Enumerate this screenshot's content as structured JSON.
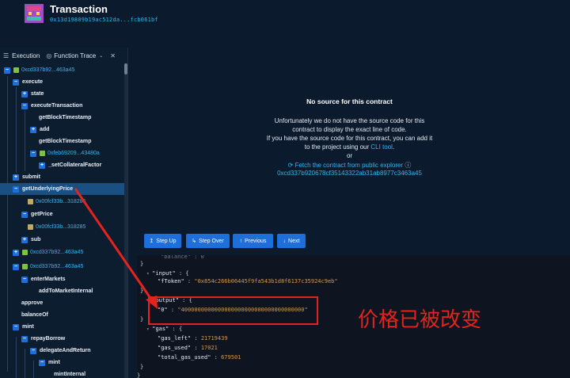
{
  "header": {
    "title": "Transaction",
    "hash": "0x13d19809b19ac512da...fcb061bf"
  },
  "sidebar": {
    "execution_label": "Execution",
    "function_trace_label": "Function Trace",
    "items": [
      {
        "label": "0xcd337b92...463a45",
        "contract": true
      },
      {
        "label": "execute"
      },
      {
        "label": "state"
      },
      {
        "label": "executeTransaction"
      },
      {
        "label": "getBlockTimestamp"
      },
      {
        "label": "add"
      },
      {
        "label": "getBlockTimestamp"
      },
      {
        "label": "0xfeb69209...43480a",
        "contract": true
      },
      {
        "label": "_setCollateralFactor"
      },
      {
        "label": "submit"
      },
      {
        "label": "getUnderlyingPrice"
      },
      {
        "label": "0x00fcf33b...318285",
        "contract": true
      },
      {
        "label": "getPrice"
      },
      {
        "label": "0x00fcf33b...318285",
        "contract": true
      },
      {
        "label": "sub"
      },
      {
        "label": "0xcd337b92...463a45",
        "contract": true
      },
      {
        "label": "0xcd337b92...463a45",
        "contract": true
      },
      {
        "label": "enterMarkets"
      },
      {
        "label": "addToMarketInternal"
      },
      {
        "label": "approve"
      },
      {
        "label": "balanceOf"
      },
      {
        "label": "mint"
      },
      {
        "label": "repayBorrow"
      },
      {
        "label": "delegateAndReturn"
      },
      {
        "label": "mint"
      },
      {
        "label": "mintInternal"
      }
    ]
  },
  "main": {
    "no_source_title": "No source for this contract",
    "line1": "Unfortunately we do not have the source code for this",
    "line2": "contract to display the exact line of code.",
    "line3": "If you have the source code for this contract, you can add it",
    "line4_prefix": "to the project using our ",
    "line4_link": "CLI tool",
    "line4_suffix": ".",
    "or": "or",
    "fetch_link": "Fetch the contract from public explorer",
    "address": "0xcd337b920678cf35143322ab31ab8977c3463a45"
  },
  "controls": {
    "step_up": "Step Up",
    "step_over": "Step Over",
    "previous": "Previous",
    "next": "Next"
  },
  "code": {
    "input_key": "\"input\"",
    "ftoken_key": "\"fToken\"",
    "ftoken_val": "\"0x854c266b06445f9fa543b1d8f6137c35924c9eb\"",
    "output_key": "\"output\"",
    "output0_key": "\"0\"",
    "output0_val": "\"4000000000000000000000000000000000000\"",
    "gas_key": "\"gas\"",
    "gas_left_key": "\"gas_left\"",
    "gas_left_val": "21719439",
    "gas_used_key": "\"gas_used\"",
    "gas_used_val": "17021",
    "total_gas_key": "\"total_gas_used\"",
    "total_gas_val": "679501"
  },
  "annotation": "价格已被改变",
  "colors": {
    "accent": "#1e6fd9",
    "link": "#2fb7f0",
    "annotation_red": "#e3231e"
  }
}
